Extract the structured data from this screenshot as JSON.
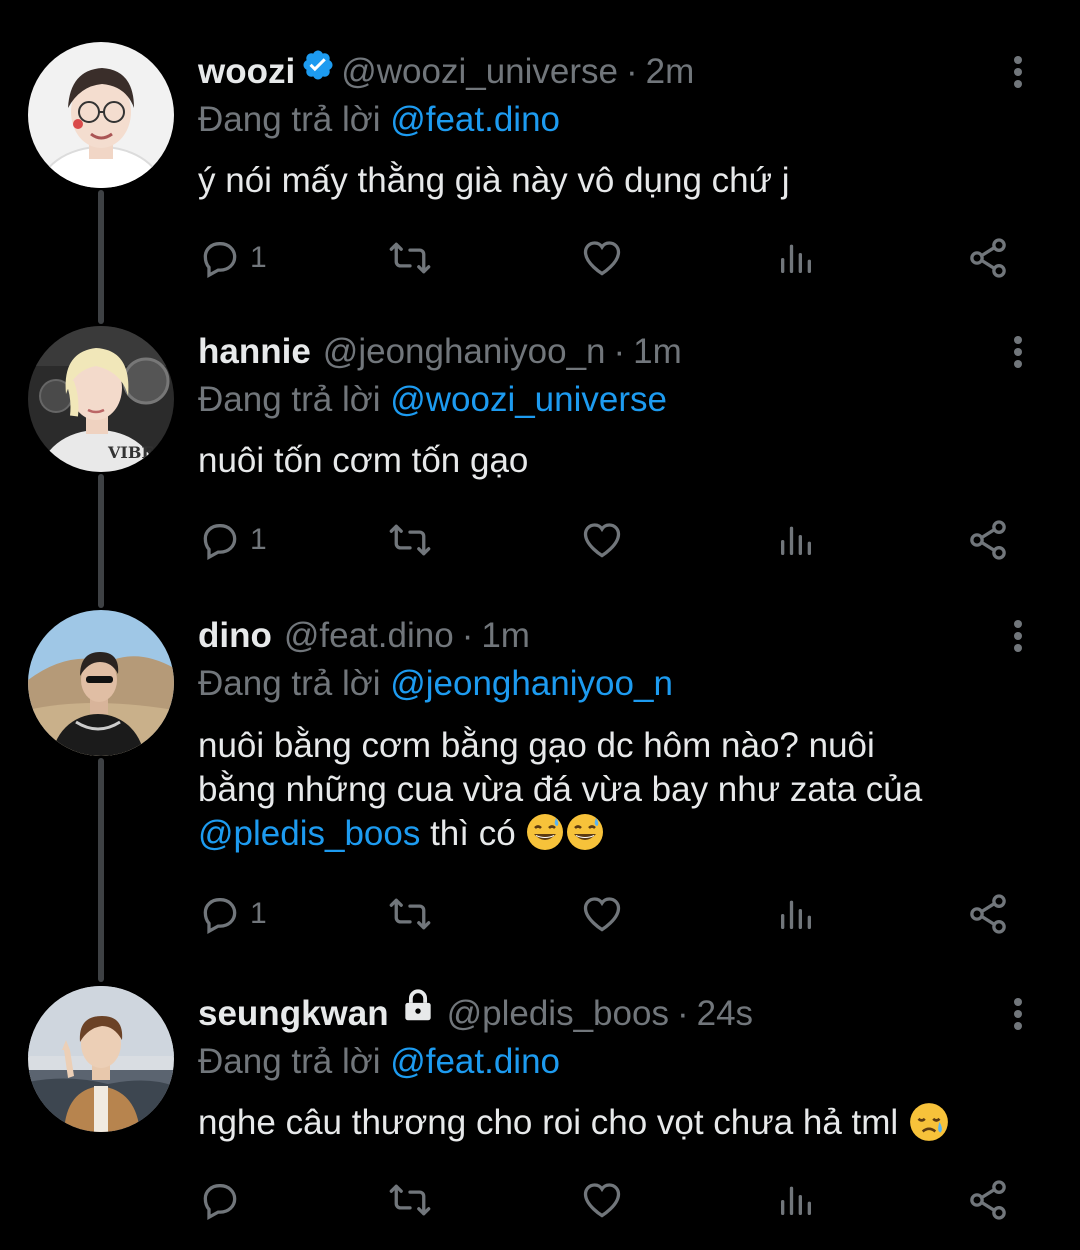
{
  "tweets": [
    {
      "display_name": "woozi",
      "handle": "@woozi_universe",
      "separator": "·",
      "time": "2m",
      "badge": "verified-icon",
      "replying_prefix": "Đang trả lời",
      "replying_to": "@feat.dino",
      "text": "ý nói mấy thằng già này vô dụng chứ j",
      "reply_count": "1",
      "avatar": "woozi-avatar"
    },
    {
      "display_name": "hannie",
      "handle": "@jeonghaniyoo_n",
      "separator": "·",
      "time": "1m",
      "replying_prefix": "Đang trả lời",
      "replying_to": "@woozi_universe",
      "text": "nuôi tốn cơm tốn gạo",
      "reply_count": "1",
      "avatar": "hannie-avatar",
      "avatar_text": "VIBE"
    },
    {
      "display_name": "dino",
      "handle": "@feat.dino",
      "separator": "·",
      "time": "1m",
      "replying_prefix": "Đang trả lời",
      "replying_to": "@jeonghaniyoo_n",
      "text_line1": "nuôi bằng cơm bằng gạo dc hôm nào? nuôi",
      "text_line2": "bằng những cua vừa đá vừa bay như zata của",
      "text_mention": "@pledis_boos",
      "text_tail": " thì có ",
      "emoji": "sweat-smile-emoji",
      "reply_count": "1",
      "avatar": "dino-avatar"
    },
    {
      "display_name": "seungkwan",
      "handle": "@pledis_boos",
      "separator": "·",
      "time": "24s",
      "badge": "lock-icon",
      "replying_prefix": "Đang trả lời",
      "replying_to": "@feat.dino",
      "text": "nghe câu thương cho roi cho vọt chưa hả tml ",
      "emoji": "sad-sweat-emoji",
      "reply_count": "",
      "avatar": "seungkwan-avatar"
    }
  ],
  "colors": {
    "background": "#000000",
    "text": "#e7e9ea",
    "secondary": "#71767b",
    "accent": "#1d9bf0",
    "thread_line": "#3e4144"
  }
}
